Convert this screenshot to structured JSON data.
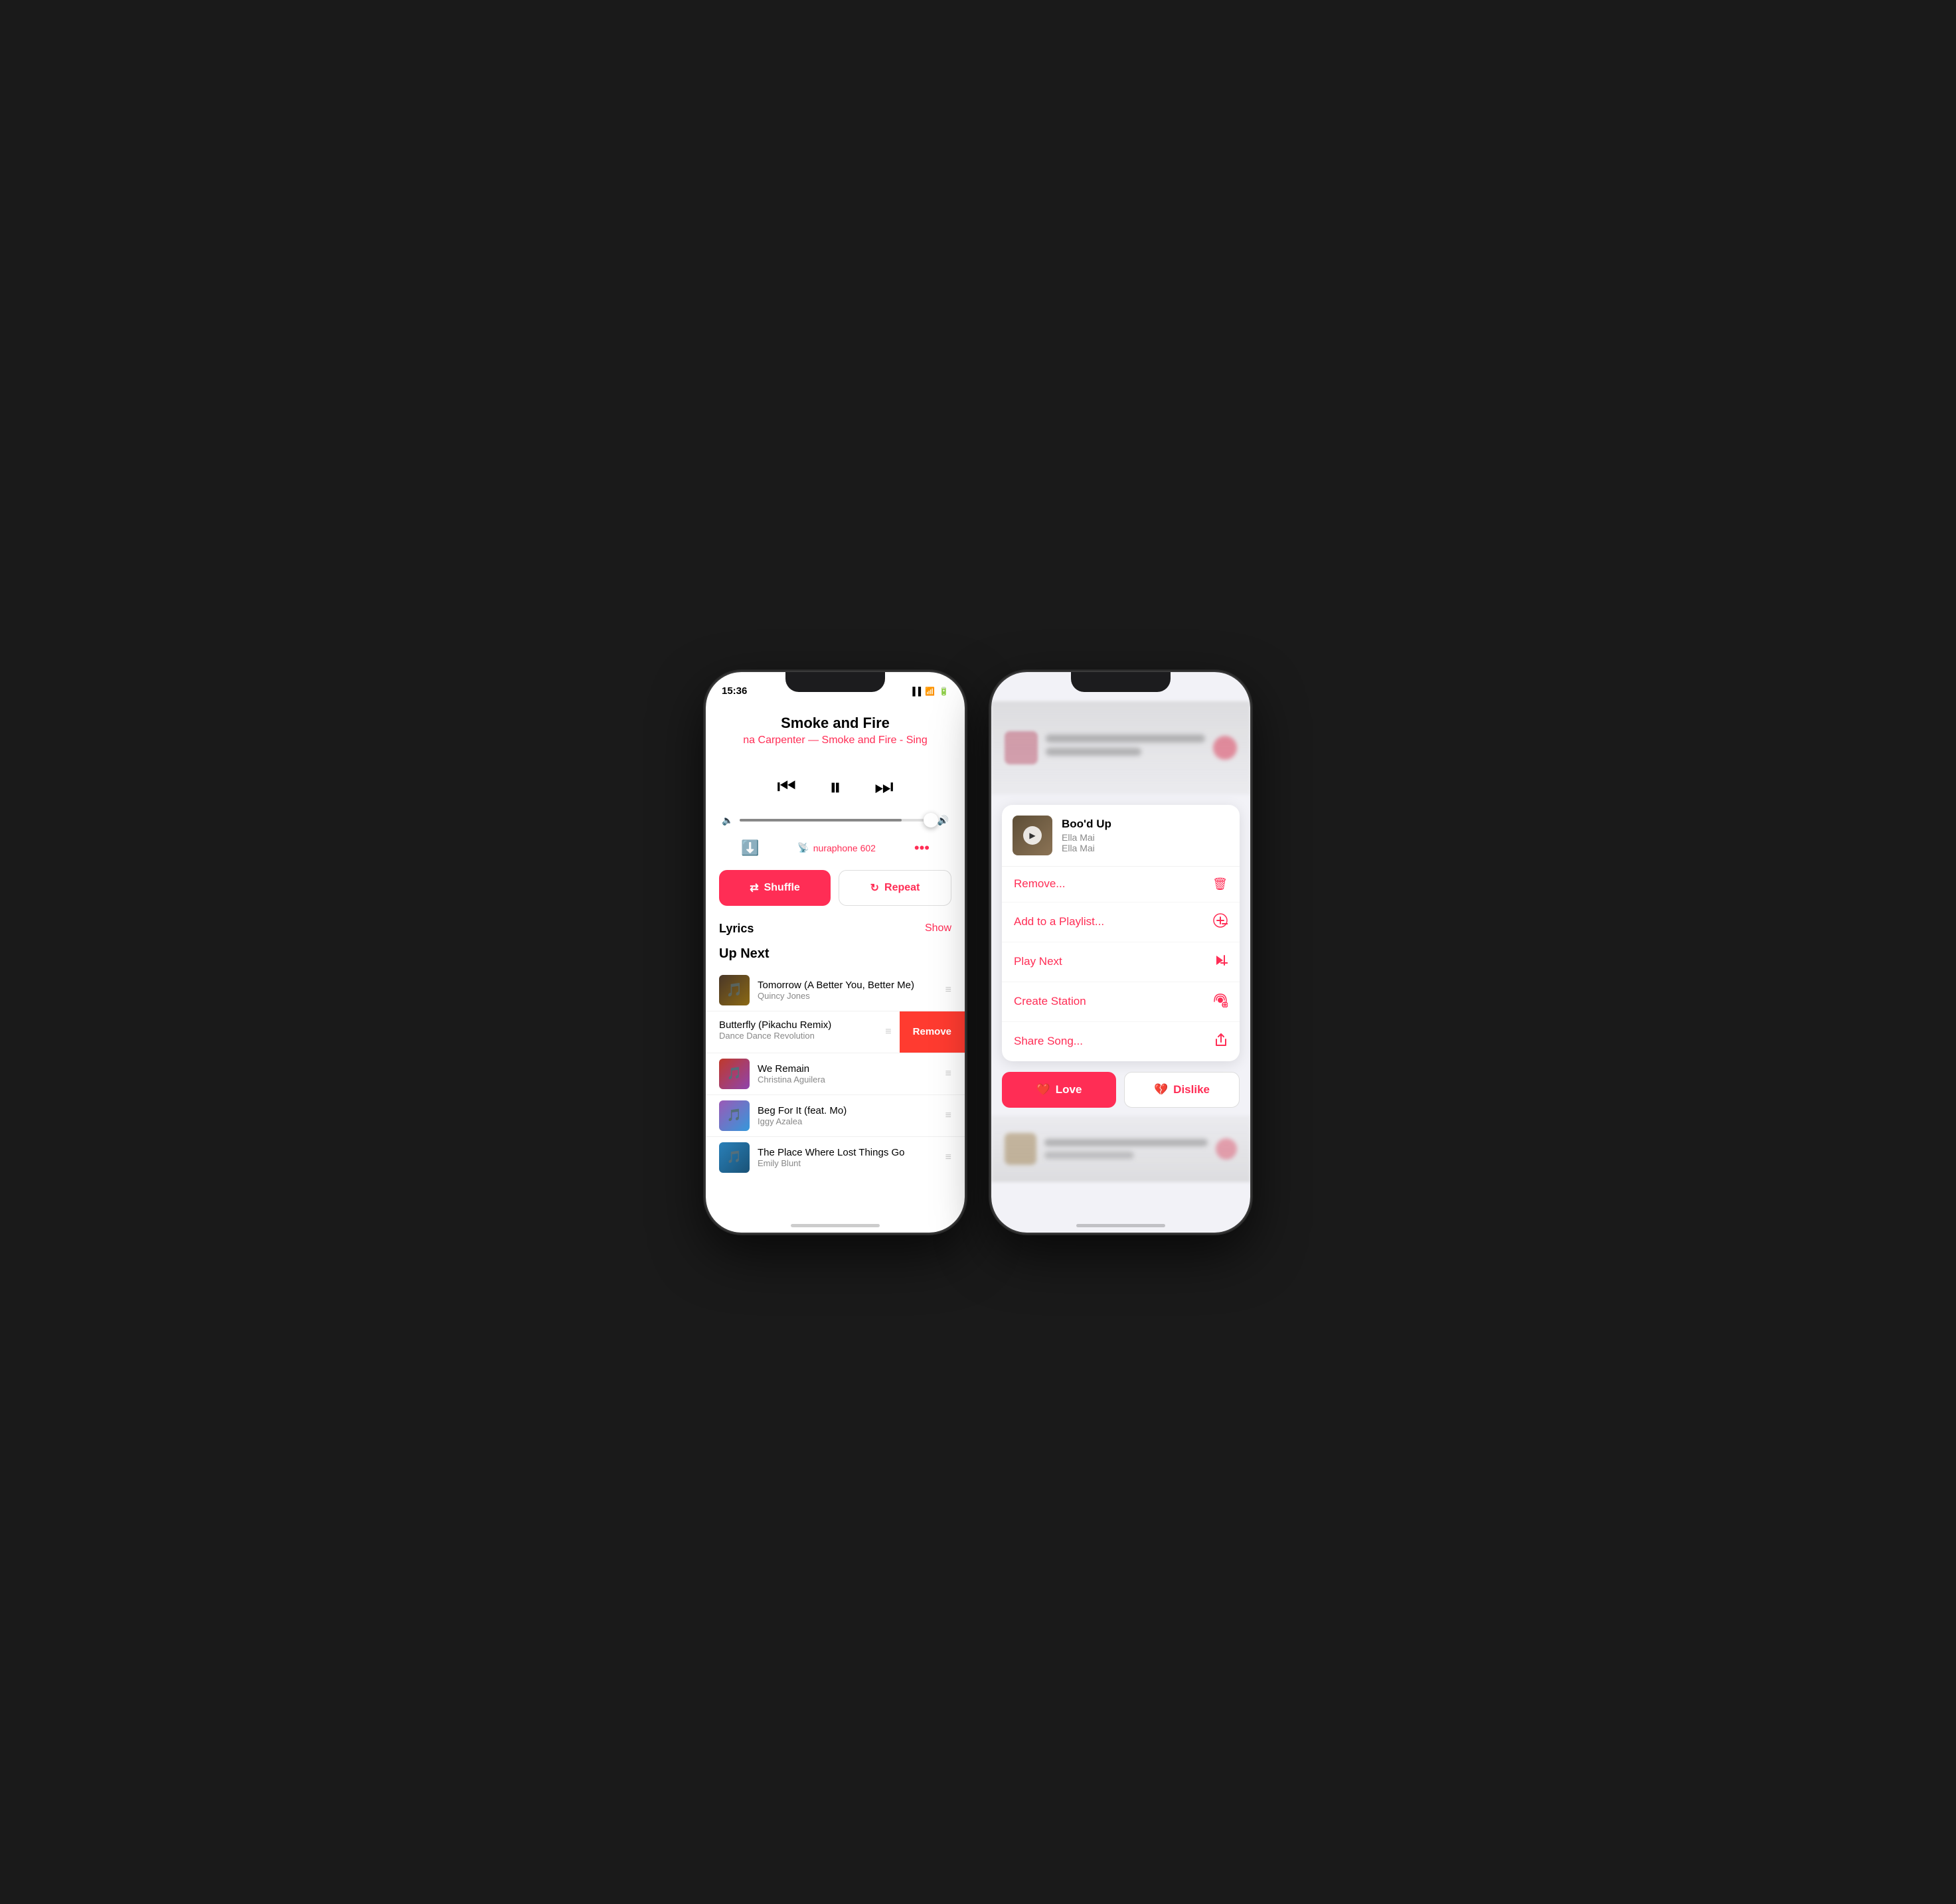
{
  "phone1": {
    "status": {
      "time": "15:36"
    },
    "track": {
      "title": "Smoke and Fire",
      "subtitle": "na Carpenter — Smoke and Fire - Sing"
    },
    "volume": {
      "level": 85
    },
    "device": {
      "name": "nuraphone 602"
    },
    "shuffle": {
      "label": "Shuffle"
    },
    "repeat": {
      "label": "Repeat"
    },
    "lyrics": {
      "label": "Lyrics",
      "show_label": "Show"
    },
    "up_next": {
      "label": "Up Next"
    },
    "queue": [
      {
        "title": "Tomorrow (A Better You, Better Me)",
        "artist": "Quincy Jones",
        "has_art": true,
        "art_class": "art-quincy"
      },
      {
        "title": "Butterfly (Pikachu Remix)",
        "artist": "Dance Dance Revolution",
        "has_art": false,
        "swiped": true
      },
      {
        "title": "We Remain",
        "artist": "Christina Aguilera",
        "has_art": true,
        "art_class": "art-we-remain"
      },
      {
        "title": "Beg For It (feat. Mo)",
        "artist": "Iggy Azalea",
        "has_art": true,
        "art_class": "art-iggy"
      },
      {
        "title": "The Place Where Lost Things Go",
        "artist": "Emily Blunt",
        "has_art": true,
        "art_class": "art-emily"
      }
    ],
    "remove_label": "Remove"
  },
  "phone2": {
    "context_menu": {
      "song": {
        "title": "Boo'd Up",
        "album": "Ella Mai",
        "artist": "Ella Mai"
      },
      "items": [
        {
          "label": "Remove...",
          "icon": "trash"
        },
        {
          "label": "Add to a Playlist...",
          "icon": "add-playlist"
        },
        {
          "label": "Play Next",
          "icon": "play-next"
        },
        {
          "label": "Create Station",
          "icon": "create-station"
        },
        {
          "label": "Share Song...",
          "icon": "share"
        }
      ],
      "love_label": "Love",
      "dislike_label": "Dislike"
    }
  }
}
